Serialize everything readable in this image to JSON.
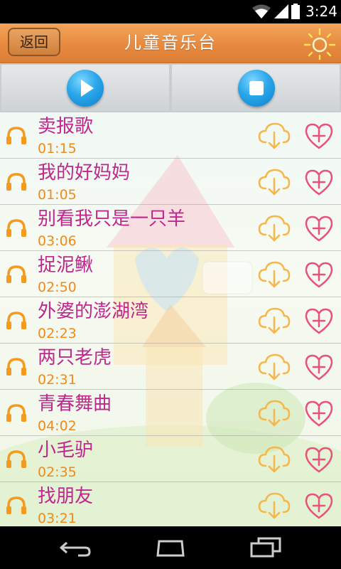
{
  "status_bar": {
    "time": "3:24"
  },
  "header": {
    "back_label": "返回",
    "title": "儿童音乐台"
  },
  "controls": {
    "play_icon": "play-icon",
    "stop_icon": "stop-icon"
  },
  "songs": [
    {
      "title": "卖报歌",
      "duration": "01:15"
    },
    {
      "title": "我的好妈妈",
      "duration": "01:05"
    },
    {
      "title": "别看我只是一只羊",
      "duration": "03:06"
    },
    {
      "title": "捉泥鳅",
      "duration": "02:50"
    },
    {
      "title": "外婆的澎湖湾",
      "duration": "02:23"
    },
    {
      "title": "两只老虎",
      "duration": "02:31"
    },
    {
      "title": "青春舞曲",
      "duration": "04:02"
    },
    {
      "title": "小毛驴",
      "duration": "02:35"
    },
    {
      "title": "找朋友",
      "duration": "03:21"
    }
  ],
  "colors": {
    "title_bar": "#e78a3f",
    "song_title": "#c0278e",
    "duration": "#f08a1a",
    "accent_blue": "#2aa7ea"
  }
}
